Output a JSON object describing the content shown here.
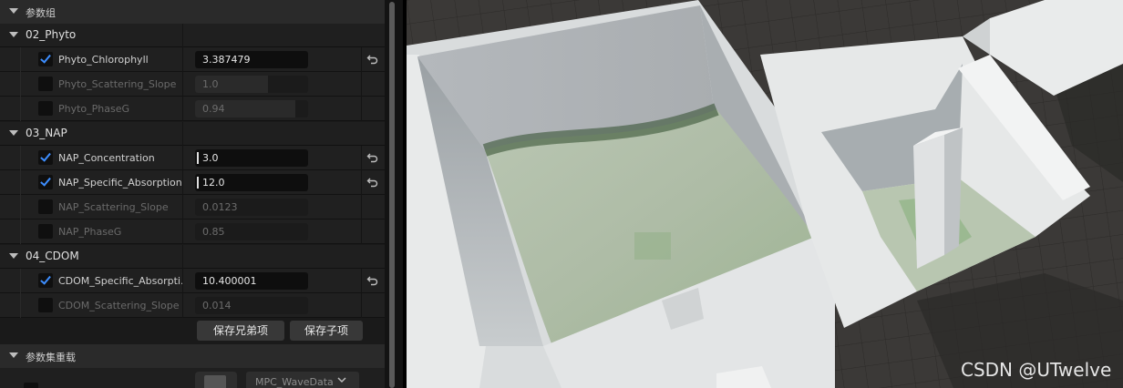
{
  "panel": {
    "section_title": "参数组",
    "groups": [
      {
        "name": "02_Phyto",
        "params": [
          {
            "name": "Phyto_Chlorophyll",
            "value": "3.387479",
            "enabled": true
          },
          {
            "name": "Phyto_Scattering_Slope",
            "value": "1.0",
            "enabled": false
          },
          {
            "name": "Phyto_PhaseG",
            "value": "0.94",
            "enabled": false
          }
        ]
      },
      {
        "name": "03_NAP",
        "params": [
          {
            "name": "NAP_Concentration",
            "value": "3.0",
            "enabled": true
          },
          {
            "name": "NAP_Specific_Absorption...",
            "value": "12.0",
            "enabled": true
          },
          {
            "name": "NAP_Scattering_Slope",
            "value": "0.0123",
            "enabled": false
          },
          {
            "name": "NAP_PhaseG",
            "value": "0.85",
            "enabled": false
          }
        ]
      },
      {
        "name": "04_CDOM",
        "params": [
          {
            "name": "CDOM_Specific_Absorpti...",
            "value": "10.400001",
            "enabled": true
          },
          {
            "name": "CDOM_Scattering_Slope",
            "value": "0.014",
            "enabled": false
          }
        ]
      }
    ],
    "buttons": {
      "save_sibling": "保存兄弟项",
      "save_child": "保存子项"
    },
    "asset_section_title": "参数集重载",
    "asset": {
      "selected": "MPC_WaveData"
    }
  },
  "icons": {
    "reset": "reset-to-default-icon",
    "collapse": "collapse-arrow-icon",
    "checkbox": "checkbox-check-icon",
    "dropdown": "chevron-down-icon"
  },
  "watermark": "CSDN @UTwelve"
}
